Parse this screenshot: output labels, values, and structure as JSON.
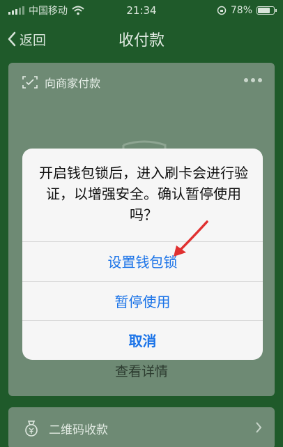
{
  "status_bar": {
    "carrier": "中国移动",
    "time": "21:34",
    "battery_percent": "78%",
    "battery_level": 0.78
  },
  "nav": {
    "back_label": "返回",
    "title": "收付款"
  },
  "card": {
    "header_label": "向商家付款",
    "detail_label": "查看详情"
  },
  "bottom": {
    "label": "二维码收款"
  },
  "dialog": {
    "message": "开启钱包锁后，进入刷卡会进行验证，以增强安全。确认暂停使用吗？",
    "buttons": {
      "set_lock": "设置钱包锁",
      "pause": "暂停使用",
      "cancel": "取消"
    }
  },
  "colors": {
    "background": "#1f5a2a",
    "card": "#6e8a74",
    "dialog_bg": "#f6f6f6",
    "button_text": "#1a73e8",
    "annotation_arrow": "#e03030"
  },
  "icons": {
    "scan": "scan-frame-icon",
    "more": "more-dots-icon",
    "money_bag": "money-bag-icon",
    "back": "chevron-left-icon",
    "forward": "chevron-right-icon"
  }
}
